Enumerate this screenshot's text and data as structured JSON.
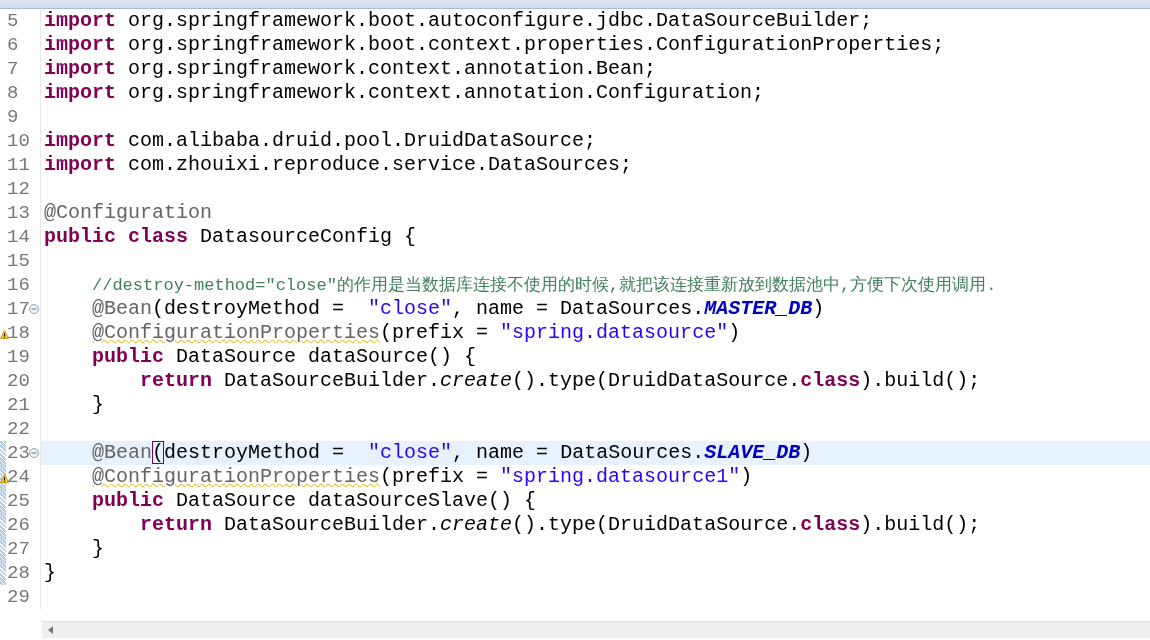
{
  "lines": [
    {
      "number": "5",
      "tokens": [
        {
          "kind": "keyword",
          "text": "import"
        },
        {
          "kind": "plain",
          "text": " org.springframework.boot.autoconfigure.jdbc.DataSourceBuilder;"
        }
      ]
    },
    {
      "number": "6",
      "tokens": [
        {
          "kind": "keyword",
          "text": "import"
        },
        {
          "kind": "plain",
          "text": " org.springframework.boot.context.properties.ConfigurationProperties;"
        }
      ]
    },
    {
      "number": "7",
      "tokens": [
        {
          "kind": "keyword",
          "text": "import"
        },
        {
          "kind": "plain",
          "text": " org.springframework.context.annotation.Bean;"
        }
      ]
    },
    {
      "number": "8",
      "tokens": [
        {
          "kind": "keyword",
          "text": "import"
        },
        {
          "kind": "plain",
          "text": " org.springframework.context.annotation.Configuration;"
        }
      ]
    },
    {
      "number": "9"
    },
    {
      "number": "10",
      "tokens": [
        {
          "kind": "keyword",
          "text": "import"
        },
        {
          "kind": "plain",
          "text": " com.alibaba.druid.pool.DruidDataSource;"
        }
      ]
    },
    {
      "number": "11",
      "tokens": [
        {
          "kind": "keyword",
          "text": "import"
        },
        {
          "kind": "plain",
          "text": " com.zhouixi.reproduce.service.DataSources;"
        }
      ]
    },
    {
      "number": "12"
    },
    {
      "number": "13",
      "tokens": [
        {
          "kind": "annotation",
          "text": "@Configuration"
        }
      ]
    },
    {
      "number": "14",
      "tokens": [
        {
          "kind": "keyword",
          "text": "public class"
        },
        {
          "kind": "plain",
          "text": " DatasourceConfig {"
        }
      ]
    },
    {
      "number": "15"
    },
    {
      "number": "16",
      "tokens": [
        {
          "kind": "comment",
          "text": "    //destroy-method=\"close\"的作用是当数据库连接不使用的时候,就把该连接重新放到数据池中,方便下次使用调用."
        }
      ]
    },
    {
      "number": "17",
      "fold": true,
      "tokens": [
        {
          "kind": "annotation",
          "text": "    @Bean"
        },
        {
          "kind": "plain",
          "text": "(destroyMethod =  "
        },
        {
          "kind": "string",
          "text": "\"close\""
        },
        {
          "kind": "plain",
          "text": ", name = DataSources."
        },
        {
          "kind": "constant",
          "text": "MASTER_DB"
        },
        {
          "kind": "plain",
          "text": ")"
        }
      ]
    },
    {
      "number": "18",
      "warning": true,
      "tokens": [
        {
          "kind": "annotation-warning",
          "text": "    @ConfigurationProperties"
        },
        {
          "kind": "plain",
          "text": "(prefix = "
        },
        {
          "kind": "string",
          "text": "\"spring.datasource\""
        },
        {
          "kind": "plain",
          "text": ")"
        }
      ]
    },
    {
      "number": "19",
      "tokens": [
        {
          "kind": "keyword",
          "text": "    public"
        },
        {
          "kind": "plain",
          "text": " DataSource dataSource() {"
        }
      ]
    },
    {
      "number": "20",
      "tokens": [
        {
          "kind": "keyword",
          "text": "        return"
        },
        {
          "kind": "plain",
          "text": " DataSourceBuilder."
        },
        {
          "kind": "static-call",
          "text": "create"
        },
        {
          "kind": "plain",
          "text": "().type(DruidDataSource."
        },
        {
          "kind": "keyword",
          "text": "class"
        },
        {
          "kind": "plain",
          "text": ").build();"
        }
      ]
    },
    {
      "number": "21",
      "tokens": [
        {
          "kind": "plain",
          "text": "    }"
        }
      ]
    },
    {
      "number": "22"
    },
    {
      "number": "23",
      "fold": true,
      "current": true,
      "changed": true,
      "tokens": [
        {
          "kind": "annotation",
          "text": "    @Bean"
        },
        {
          "kind": "bracket-match",
          "text": "("
        },
        {
          "kind": "plain",
          "text": "destroyMethod =  "
        },
        {
          "kind": "string",
          "text": "\"close\""
        },
        {
          "kind": "plain",
          "text": ", name = DataSources."
        },
        {
          "kind": "constant",
          "text": "SLAVE_DB"
        },
        {
          "kind": "plain",
          "text": ")"
        }
      ]
    },
    {
      "number": "24",
      "warning": true,
      "changed": true,
      "tokens": [
        {
          "kind": "annotation-warning",
          "text": "    @ConfigurationProperties"
        },
        {
          "kind": "plain",
          "text": "(prefix = "
        },
        {
          "kind": "string",
          "text": "\"spring.datasource1\""
        },
        {
          "kind": "plain",
          "text": ")"
        }
      ]
    },
    {
      "number": "25",
      "changed": true,
      "tokens": [
        {
          "kind": "keyword",
          "text": "    public"
        },
        {
          "kind": "plain",
          "text": " DataSource dataSourceSlave() {"
        }
      ]
    },
    {
      "number": "26",
      "changed": true,
      "tokens": [
        {
          "kind": "keyword",
          "text": "        return"
        },
        {
          "kind": "plain",
          "text": " DataSourceBuilder."
        },
        {
          "kind": "static-call",
          "text": "create"
        },
        {
          "kind": "plain",
          "text": "().type(DruidDataSource."
        },
        {
          "kind": "keyword",
          "text": "class"
        },
        {
          "kind": "plain",
          "text": ").build();"
        }
      ]
    },
    {
      "number": "27",
      "changed": true,
      "tokens": [
        {
          "kind": "plain",
          "text": "    }"
        }
      ]
    },
    {
      "number": "28",
      "changed": true,
      "tokens": [
        {
          "kind": "plain",
          "text": "}"
        }
      ]
    },
    {
      "number": "29"
    }
  ]
}
